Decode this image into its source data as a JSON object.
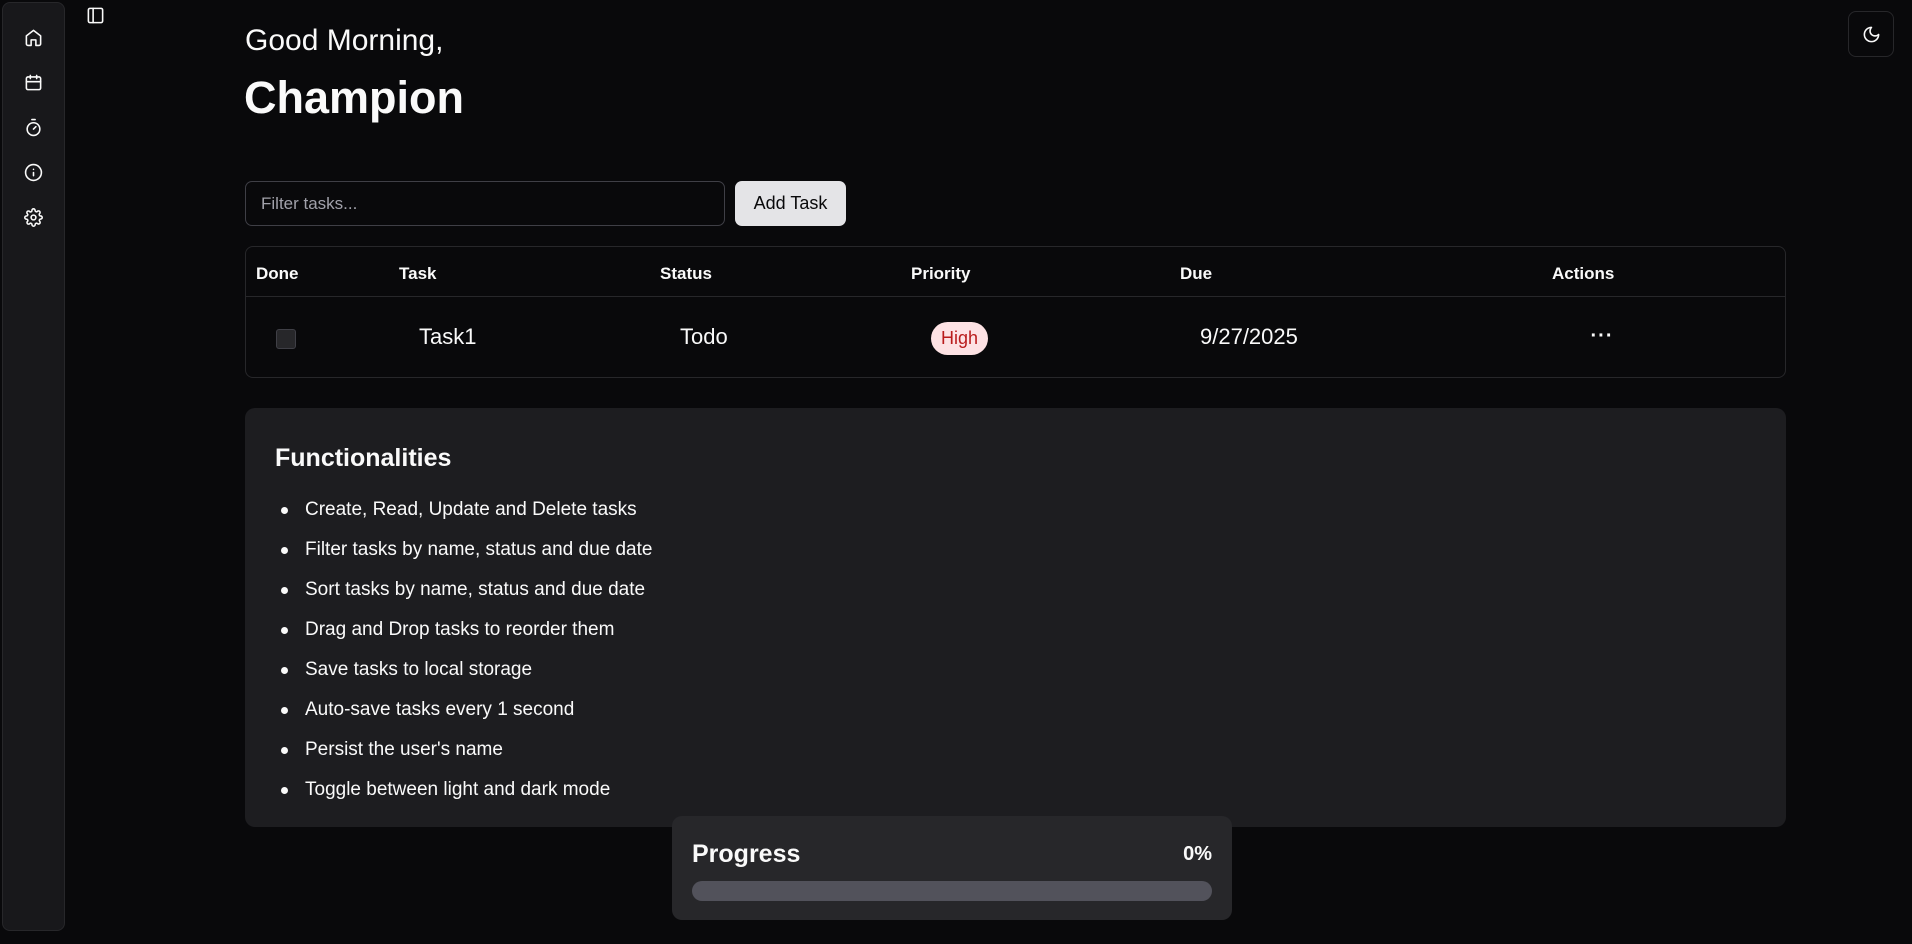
{
  "sidebar": {
    "items": [
      {
        "icon": "home-icon",
        "name": "home"
      },
      {
        "icon": "calendar-icon",
        "name": "calendar"
      },
      {
        "icon": "timer-icon",
        "name": "timer"
      },
      {
        "icon": "info-icon",
        "name": "info"
      },
      {
        "icon": "gear-icon",
        "name": "settings"
      }
    ]
  },
  "header": {
    "greeting": "Good Morning,",
    "username": "Champion"
  },
  "toolbar": {
    "filter_placeholder": "Filter tasks...",
    "filter_value": "",
    "add_label": "Add Task"
  },
  "table": {
    "columns": [
      "Done",
      "Task",
      "Status",
      "Priority",
      "Due",
      "Actions"
    ],
    "rows": [
      {
        "done": false,
        "task": "Task1",
        "status": "Todo",
        "priority": "High",
        "due": "9/27/2025",
        "actions_label": "···"
      }
    ]
  },
  "functionalities": {
    "title": "Functionalities",
    "items": [
      "Create, Read, Update and Delete tasks",
      "Filter tasks by name, status and due date",
      "Sort tasks by name, status and due date",
      "Drag and Drop tasks to reorder them",
      "Save tasks to local storage",
      "Auto-save tasks every 1 second",
      "Persist the user's name",
      "Toggle between light and dark mode"
    ]
  },
  "progress": {
    "label": "Progress",
    "percent_text": "0%",
    "fraction": 0
  },
  "colors": {
    "background": "#09090b",
    "priority_high_bg": "#fde2e4",
    "priority_high_text": "#b91c1c"
  }
}
